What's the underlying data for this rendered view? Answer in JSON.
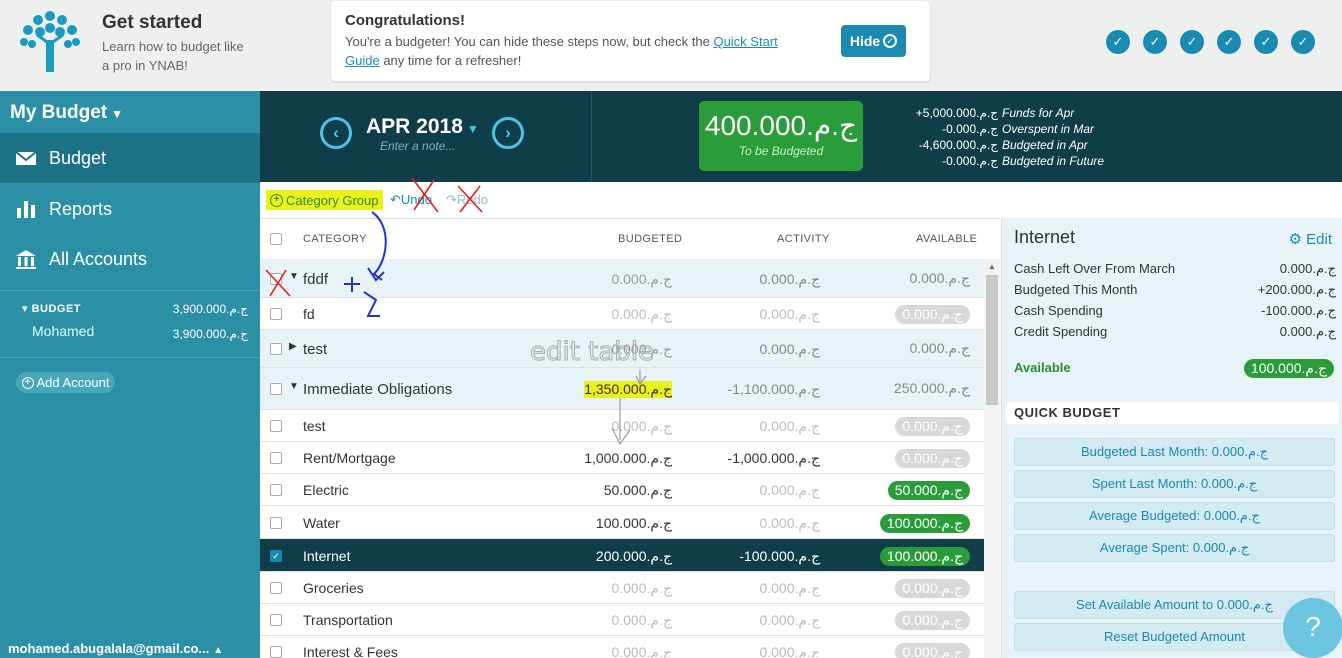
{
  "top": {
    "title": "Get started",
    "subtitle": "Learn how to budget like a pro in YNAB!",
    "congrats_title": "Congratulations!",
    "congrats_msg_pre": "You're a budgeter! You can hide these steps now, but check the ",
    "congrats_link": "Quick Start Guide",
    "congrats_msg_post": " any time for a refresher!",
    "hide_label": "Hide",
    "steps_done": 6
  },
  "sidebar": {
    "budget_name": "My Budget",
    "nav": [
      {
        "label": "Budget",
        "icon": "envelope-icon"
      },
      {
        "label": "Reports",
        "icon": "bar-chart-icon"
      },
      {
        "label": "All Accounts",
        "icon": "bank-icon"
      }
    ],
    "accounts_header": "BUDGET",
    "accounts_header_balance": "ج.م.3,900.000",
    "account_name": "Mohamed",
    "account_balance": "ج.م.3,900.000",
    "add_account": "Add Account",
    "email": "mohamed.abugalala@gmail.co..."
  },
  "header": {
    "month": "APR 2018",
    "note_placeholder": "Enter a note...",
    "to_be_budgeted": "ج.م.400.000",
    "to_be_budgeted_label": "To be Budgeted",
    "funds": [
      {
        "amount": "+ج.م.5,000.000",
        "label": "Funds for Apr"
      },
      {
        "amount": "-ج.م.0.000",
        "label": "Overspent in Mar"
      },
      {
        "amount": "-ج.م.4,600.000",
        "label": "Budgeted in Apr"
      },
      {
        "amount": "-ج.م.0.000",
        "label": "Budgeted in Future"
      }
    ]
  },
  "toolbar": {
    "category_group": "Category Group",
    "undo": "Undo",
    "redo": "Redo"
  },
  "table": {
    "headers": {
      "category": "CATEGORY",
      "budgeted": "BUDGETED",
      "activity": "ACTIVITY",
      "available": "AVAILABLE"
    },
    "rows": [
      {
        "name": "fddf",
        "group": true,
        "expanded": true,
        "budgeted": "ج.م.0.000",
        "activity": "ج.م.0.000",
        "available": "ج.م.0.000",
        "avail_style": "plain"
      },
      {
        "name": "fd",
        "group": false,
        "budgeted": "ج.م.0.000",
        "activity": "ج.م.0.000",
        "available": "ج.م.0.000",
        "avail_style": "grey"
      },
      {
        "name": "test",
        "group": true,
        "expanded": false,
        "budgeted": "ج.م.0.000",
        "activity": "ج.م.0.000",
        "available": "ج.م.0.000",
        "avail_style": "plain"
      },
      {
        "name": "Immediate Obligations",
        "group": true,
        "expanded": true,
        "budgeted": "ج.م.1,350.000",
        "activity": "-ج.م.1,100.000",
        "available": "ج.م.250.000",
        "avail_style": "plain"
      },
      {
        "name": "test",
        "group": false,
        "budgeted": "ج.م.0.000",
        "activity": "ج.م.0.000",
        "available": "ج.م.0.000",
        "avail_style": "grey"
      },
      {
        "name": "Rent/Mortgage",
        "group": false,
        "budgeted": "ج.م.1,000.000",
        "activity": "-ج.م.1,000.000",
        "available": "ج.م.0.000",
        "avail_style": "grey"
      },
      {
        "name": "Electric",
        "group": false,
        "budgeted": "ج.م.50.000",
        "activity": "ج.م.0.000",
        "available": "ج.م.50.000",
        "avail_style": "green"
      },
      {
        "name": "Water",
        "group": false,
        "budgeted": "ج.م.100.000",
        "activity": "ج.م.0.000",
        "available": "ج.م.100.000",
        "avail_style": "green"
      },
      {
        "name": "Internet",
        "group": false,
        "selected": true,
        "budgeted": "ج.م.200.000",
        "activity": "-ج.م.100.000",
        "available": "ج.م.100.000",
        "avail_style": "green"
      },
      {
        "name": "Groceries",
        "group": false,
        "budgeted": "ج.م.0.000",
        "activity": "ج.م.0.000",
        "available": "ج.م.0.000",
        "avail_style": "grey"
      },
      {
        "name": "Transportation",
        "group": false,
        "budgeted": "ج.م.0.000",
        "activity": "ج.م.0.000",
        "available": "ج.م.0.000",
        "avail_style": "grey"
      },
      {
        "name": "Interest & Fees",
        "group": false,
        "budgeted": "ج.م.0.000",
        "activity": "ج.م.0.000",
        "available": "ج.م.0.000",
        "avail_style": "grey"
      }
    ]
  },
  "inspector": {
    "title": "Internet",
    "edit": "Edit",
    "lines": [
      {
        "label": "Cash Left Over From March",
        "value": "ج.م.0.000"
      },
      {
        "label": "Budgeted This Month",
        "value": "+ج.م.200.000"
      },
      {
        "label": "Cash Spending",
        "value": "-ج.م.100.000"
      },
      {
        "label": "Credit Spending",
        "value": "ج.م.0.000"
      }
    ],
    "available_label": "Available",
    "available_value": "ج.م.100.000",
    "quick_budget_title": "QUICK BUDGET",
    "quick": [
      "Budgeted Last Month: ج.م.0.000",
      "Spent Last Month: ج.م.0.000",
      "Average Budgeted: ج.م.0.000",
      "Average Spent: ج.م.0.000",
      "Set Available Amount to ج.م.0.000",
      "Reset Budgeted Amount"
    ]
  },
  "help": "?",
  "annotation_text": "edit table",
  "colors": {
    "teal": "#2b8fa6",
    "dark": "#0f3d48",
    "green": "#2a9d3a",
    "accent": "#1a8ab0",
    "highlight": "#eaf21a"
  }
}
